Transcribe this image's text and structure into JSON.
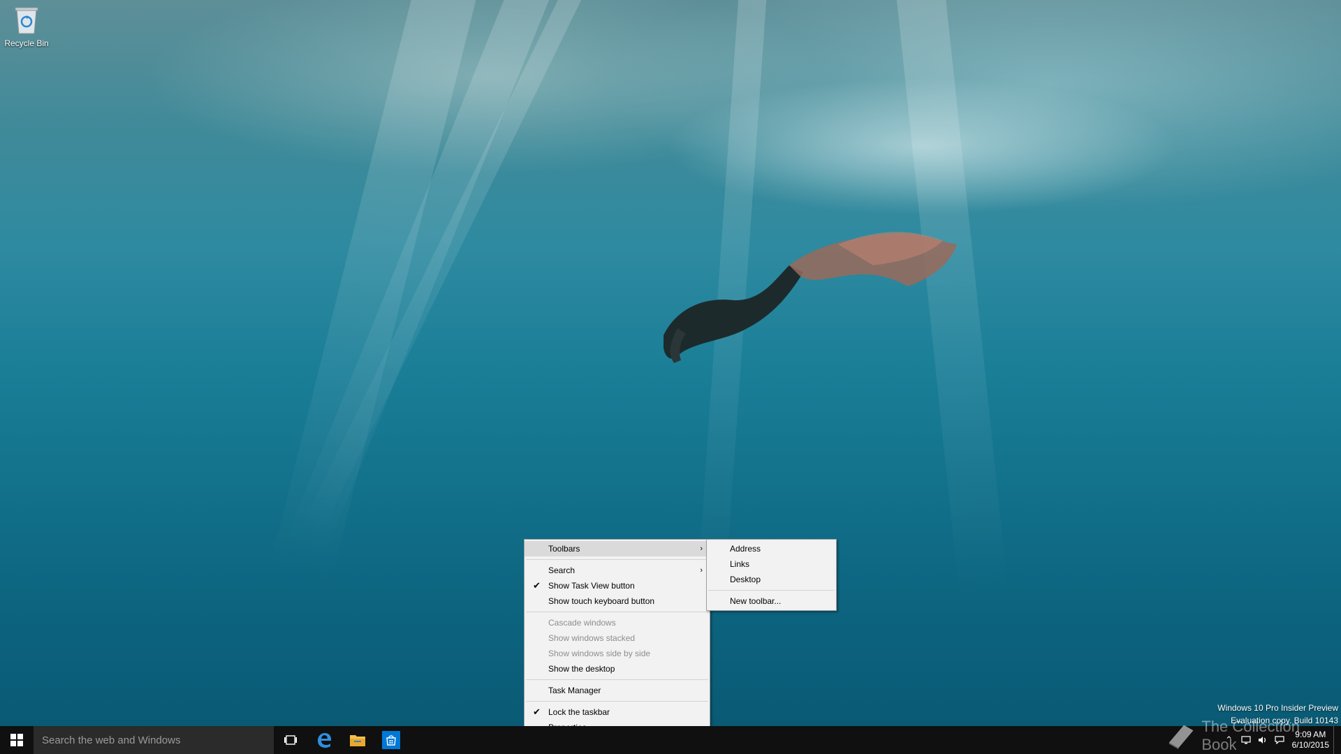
{
  "desktop": {
    "icons": [
      {
        "label": "Recycle Bin",
        "icon": "recycle-bin-icon"
      }
    ],
    "watermark": {
      "line1": "Windows 10 Pro Insider Preview",
      "line2": "Evaluation copy. Build 10143"
    },
    "site_mark": "The Collection Book"
  },
  "taskbar": {
    "search_placeholder": "Search the web and Windows",
    "pinned": [
      {
        "name": "task-view",
        "icon": "task-view-icon"
      },
      {
        "name": "edge",
        "icon": "edge-icon"
      },
      {
        "name": "file-explorer",
        "icon": "folder-icon"
      },
      {
        "name": "store",
        "icon": "store-icon"
      }
    ],
    "clock": {
      "time": "9:09 AM",
      "date": "6/10/2015"
    }
  },
  "context_menu": {
    "items": {
      "toolbars": "Toolbars",
      "search": "Search",
      "show_task_view": "Show Task View button",
      "show_touch_keyboard": "Show touch keyboard button",
      "cascade": "Cascade windows",
      "stacked": "Show windows stacked",
      "side_by_side": "Show windows side by side",
      "show_desktop": "Show the desktop",
      "task_manager": "Task Manager",
      "lock_taskbar": "Lock the taskbar",
      "properties": "Properties"
    },
    "checked": [
      "Show Task View button",
      "Lock the taskbar"
    ],
    "disabled": [
      "Cascade windows",
      "Show windows stacked",
      "Show windows side by side"
    ]
  },
  "toolbars_submenu": {
    "address": "Address",
    "links": "Links",
    "desktop": "Desktop",
    "new_toolbar": "New toolbar..."
  },
  "colors": {
    "taskbar": "#101010",
    "search_box": "#2b2b2b",
    "menu_bg": "#f2f2f2",
    "menu_highlight": "#dadada",
    "accent": "#0078d7"
  }
}
